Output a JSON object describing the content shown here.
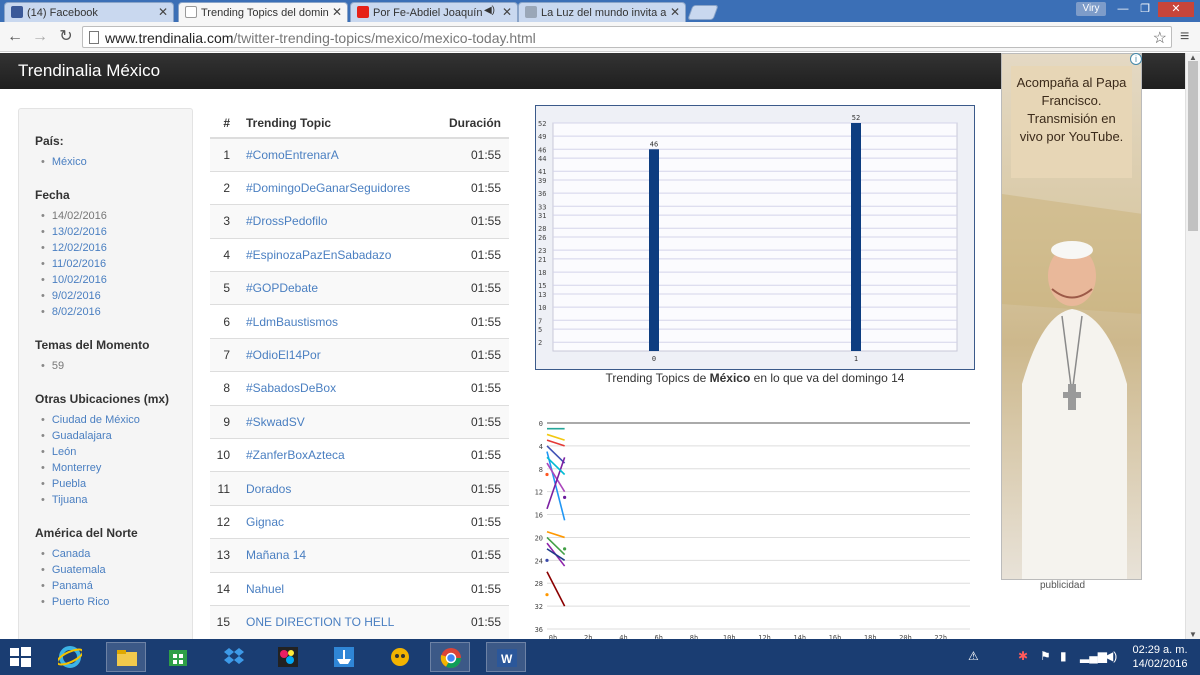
{
  "browser": {
    "tabs": [
      {
        "title": "(14) Facebook",
        "color": "#3b5998"
      },
      {
        "title": "Trending Topics del domin",
        "color": "#999999"
      },
      {
        "title": "Por Fe-Abdiel Joaquín",
        "color": "#e62117"
      },
      {
        "title": "La Luz del mundo invita a",
        "color": "#9aa7b8"
      }
    ],
    "profile": "Viry",
    "url_domain": "www.trendinalia.com",
    "url_path": "/twitter-trending-topics/mexico/mexico-today.html"
  },
  "site": {
    "brand": "Trendinalia México"
  },
  "sidebar": {
    "pais_heading": "País:",
    "pais": [
      "México"
    ],
    "fecha_heading": "Fecha",
    "fechas": [
      "14/02/2016",
      "13/02/2016",
      "12/02/2016",
      "11/02/2016",
      "10/02/2016",
      "9/02/2016",
      "8/02/2016"
    ],
    "temas_heading": "Temas del Momento",
    "temas": [
      "59"
    ],
    "otras_heading": "Otras Ubicaciones (mx)",
    "otras": [
      "Ciudad de México",
      "Guadalajara",
      "León",
      "Monterrey",
      "Puebla",
      "Tijuana"
    ],
    "america_heading": "América del Norte",
    "america": [
      "Canada",
      "Guatemala",
      "Panamá",
      "Puerto Rico"
    ]
  },
  "table": {
    "headers": {
      "num": "#",
      "topic": "Trending Topic",
      "duration": "Duración"
    },
    "rows": [
      {
        "n": "1",
        "topic": "#ComoEntrenarA",
        "dur": "01:55"
      },
      {
        "n": "2",
        "topic": "#DomingoDeGanarSeguidores",
        "dur": "01:55"
      },
      {
        "n": "3",
        "topic": "#DrossPedofilo",
        "dur": "01:55"
      },
      {
        "n": "4",
        "topic": "#EspinozaPazEnSabadazo",
        "dur": "01:55"
      },
      {
        "n": "5",
        "topic": "#GOPDebate",
        "dur": "01:55"
      },
      {
        "n": "6",
        "topic": "#LdmBaustismos",
        "dur": "01:55"
      },
      {
        "n": "7",
        "topic": "#OdioEl14Por",
        "dur": "01:55"
      },
      {
        "n": "8",
        "topic": "#SabadosDeBox",
        "dur": "01:55"
      },
      {
        "n": "9",
        "topic": "#SkwadSV",
        "dur": "01:55"
      },
      {
        "n": "10",
        "topic": "#ZanferBoxAzteca",
        "dur": "01:55"
      },
      {
        "n": "11",
        "topic": "Dorados",
        "dur": "01:55"
      },
      {
        "n": "12",
        "topic": "Gignac",
        "dur": "01:55"
      },
      {
        "n": "13",
        "topic": "Mañana 14",
        "dur": "01:55"
      },
      {
        "n": "14",
        "topic": "Nahuel",
        "dur": "01:55"
      },
      {
        "n": "15",
        "topic": "ONE DIRECTION TO HELL",
        "dur": "01:55"
      }
    ]
  },
  "chart_data": [
    {
      "type": "bar",
      "categories": [
        "0",
        "1"
      ],
      "values": [
        46,
        52
      ],
      "ylim": [
        0,
        52
      ],
      "yticks": [
        2,
        5,
        7,
        10,
        13,
        15,
        18,
        21,
        23,
        26,
        28,
        31,
        33,
        36,
        39,
        41,
        44,
        46,
        49,
        52
      ],
      "grid": true,
      "bar_color": "#0d3d80",
      "caption_prefix": "Trending Topics de",
      "caption_bold": "México",
      "caption_suffix": "en lo que va del domingo 14"
    },
    {
      "type": "line",
      "xticks": [
        "0h",
        "2h",
        "4h",
        "6h",
        "8h",
        "10h",
        "12h",
        "14h",
        "16h",
        "18h",
        "20h",
        "22h"
      ],
      "yticks": [
        0,
        4,
        8,
        12,
        16,
        20,
        24,
        28,
        32,
        36
      ],
      "ylim": [
        0,
        36
      ],
      "y_inverted": true,
      "series": [
        {
          "color": "#26a69a",
          "points": [
            [
              0,
              1
            ],
            [
              1,
              1
            ]
          ]
        },
        {
          "color": "#f2c811",
          "points": [
            [
              0,
              2
            ],
            [
              1,
              3
            ]
          ]
        },
        {
          "color": "#e53935",
          "points": [
            [
              0,
              3
            ],
            [
              1,
              4
            ]
          ]
        },
        {
          "color": "#3f51b5",
          "points": [
            [
              0,
              4
            ],
            [
              1,
              7
            ]
          ]
        },
        {
          "color": "#2196f3",
          "points": [
            [
              0,
              5
            ],
            [
              1,
              17
            ]
          ]
        },
        {
          "color": "#ab47bc",
          "points": [
            [
              0,
              7
            ],
            [
              1,
              12
            ]
          ]
        },
        {
          "color": "#7b1fa2",
          "points": [
            [
              0,
              15
            ],
            [
              1,
              6
            ]
          ]
        },
        {
          "color": "#00bcd4",
          "points": [
            [
              0,
              6
            ],
            [
              1,
              9
            ]
          ]
        },
        {
          "color": "#ff9800",
          "points": [
            [
              0,
              19
            ],
            [
              1,
              20
            ]
          ]
        },
        {
          "color": "#8e24aa",
          "points": [
            [
              0,
              21
            ],
            [
              1,
              25
            ]
          ]
        },
        {
          "color": "#43a047",
          "points": [
            [
              0,
              20
            ],
            [
              1,
              23
            ]
          ]
        },
        {
          "color": "#1e3a8a",
          "points": [
            [
              0,
              22
            ],
            [
              1,
              24
            ]
          ]
        },
        {
          "color": "#8b0000",
          "points": [
            [
              0,
              26
            ],
            [
              1,
              32
            ]
          ]
        }
      ],
      "dots": [
        {
          "color": "#ff5722",
          "x": 0,
          "y": 9
        },
        {
          "color": "#6a1b9a",
          "x": 1,
          "y": 13
        },
        {
          "color": "#43a047",
          "x": 1,
          "y": 22
        },
        {
          "color": "#3949ab",
          "x": 0,
          "y": 24
        },
        {
          "color": "#ff9800",
          "x": 0,
          "y": 30
        }
      ]
    }
  ],
  "ad": {
    "text": "Acompaña al Papa Francisco. Transmisión en vivo por YouTube.",
    "footer": "publicidad"
  },
  "taskbar": {
    "time": "02:29 a. m.",
    "date": "14/02/2016"
  }
}
